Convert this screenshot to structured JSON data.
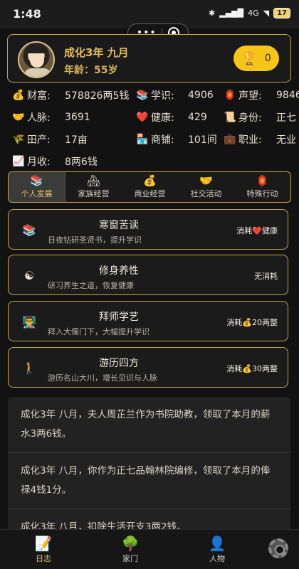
{
  "status_bar": {
    "time": "1:48",
    "bluetooth": "✱",
    "network": "4G",
    "battery": "17"
  },
  "capsule": {
    "more": "•••"
  },
  "profile": {
    "date": "成化3年 九月",
    "age": "年龄：55岁",
    "trophy_count": "0"
  },
  "stats": [
    [
      {
        "icon": "money-bag-icon",
        "glyph": "💰",
        "label": "财富:",
        "value": "578826两5钱"
      },
      {
        "icon": "books-icon",
        "glyph": "📚",
        "label": "学识:",
        "value": "4906"
      },
      {
        "icon": "lantern-icon",
        "glyph": "🏮",
        "label": "声望:",
        "value": "9846"
      }
    ],
    [
      {
        "icon": "handshake-icon",
        "glyph": "🤝",
        "label": "人脉:",
        "value": "3691"
      },
      {
        "icon": "heart-icon",
        "glyph": "❤️",
        "label": "健康:",
        "value": "429"
      },
      {
        "icon": "scroll-icon",
        "glyph": "📜",
        "label": "身份:",
        "value": "正七"
      }
    ],
    [
      {
        "icon": "rice-icon",
        "glyph": "🌾",
        "label": "田产:",
        "value": "17亩"
      },
      {
        "icon": "shop-icon",
        "glyph": "🏪",
        "label": "商铺:",
        "value": "101间"
      },
      {
        "icon": "briefcase-icon",
        "glyph": "💼",
        "label": "职业:",
        "value": "无业"
      }
    ],
    [
      {
        "icon": "chart-icon",
        "glyph": "📈",
        "label": "月收:",
        "value": "8两6钱"
      }
    ]
  ],
  "tabs": [
    {
      "icon": "books-icon",
      "glyph": "📚",
      "label": "个人发展"
    },
    {
      "icon": "house-icon",
      "glyph": "🏘",
      "label": "家族经营"
    },
    {
      "icon": "money-bag-icon",
      "glyph": "💰",
      "label": "商业经营"
    },
    {
      "icon": "handshake-icon",
      "glyph": "🤝",
      "label": "社交活动"
    },
    {
      "icon": "lantern-icon",
      "glyph": "🏮",
      "label": "特殊行动"
    }
  ],
  "actions": [
    {
      "icon": "books-icon",
      "glyph": "📚",
      "title": "寒窗苦读",
      "desc": "日夜钻研圣贤书，提升学识",
      "cost": "消耗❤️健康"
    },
    {
      "icon": "yin-yang-icon",
      "glyph": "☯",
      "title": "修身养性",
      "desc": "研习养生之道，恢复健康",
      "cost": "无消耗"
    },
    {
      "icon": "teacher-icon",
      "glyph": "👨‍🏫",
      "title": "拜师学艺",
      "desc": "拜入大儒门下，大幅提升学识",
      "cost": "消耗💰20两整"
    },
    {
      "icon": "walking-person-icon",
      "glyph": "🚶",
      "title": "游历四方",
      "desc": "游历名山大川，增长见识与人脉",
      "cost": "消耗💰30两整"
    }
  ],
  "log": [
    "成化3年 八月，夫人周芷兰作为书院助教，领取了本月的薪水3两6钱。",
    "成化3年 八月，你作为正七品翰林院编修，领取了本月的俸禄4钱1分。",
    "成化3年 八月，扣除生活开支3两2钱。"
  ],
  "bottom_nav": [
    {
      "icon": "diary-icon",
      "glyph": "📝",
      "label": "日志"
    },
    {
      "icon": "family-tree-icon",
      "glyph": "🌳",
      "label": "家门"
    },
    {
      "icon": "person-icon",
      "glyph": "👤",
      "label": "人物"
    }
  ],
  "colors": {
    "accent_gold": "#c9a44a",
    "trophy_yellow": "#f5c518",
    "background": "#121212"
  }
}
